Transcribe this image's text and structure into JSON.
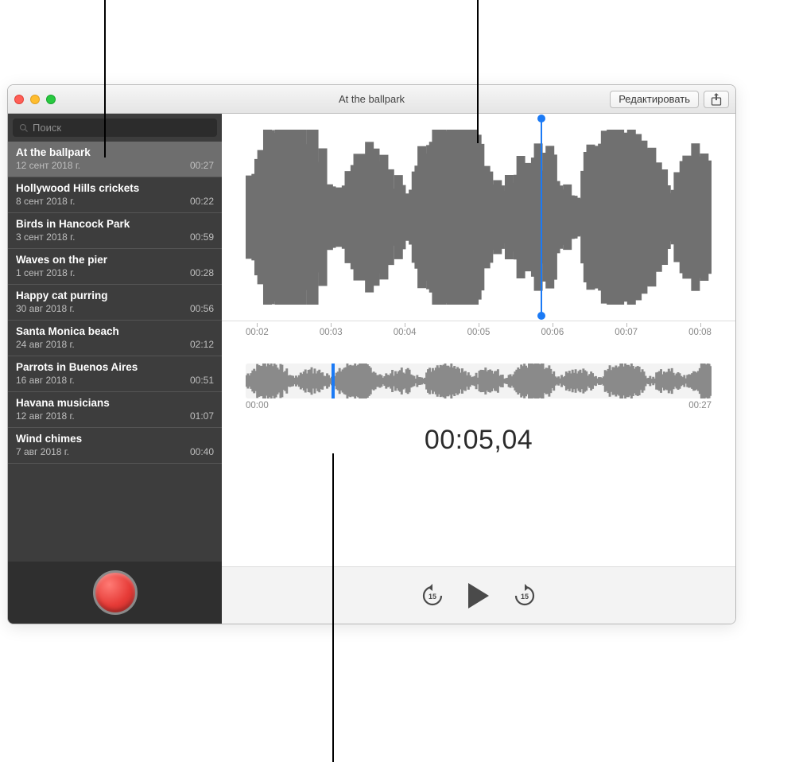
{
  "window": {
    "title": "At the ballpark",
    "edit_button": "Редактировать"
  },
  "sidebar": {
    "search_placeholder": "Поиск",
    "items": [
      {
        "title": "At the ballpark",
        "date": "12 сент 2018 г.",
        "duration": "00:27",
        "selected": true
      },
      {
        "title": "Hollywood Hills crickets",
        "date": "8 сент 2018 г.",
        "duration": "00:22"
      },
      {
        "title": "Birds in Hancock Park",
        "date": "3 сент 2018 г.",
        "duration": "00:59"
      },
      {
        "title": "Waves on the pier",
        "date": "1 сент 2018 г.",
        "duration": "00:28"
      },
      {
        "title": "Happy cat purring",
        "date": "30 авг 2018 г.",
        "duration": "00:56"
      },
      {
        "title": "Santa Monica beach",
        "date": "24 авг 2018 г.",
        "duration": "02:12"
      },
      {
        "title": "Parrots in Buenos Aires",
        "date": "16 авг 2018 г.",
        "duration": "00:51"
      },
      {
        "title": "Havana musicians",
        "date": "12 авг 2018 г.",
        "duration": "01:07"
      },
      {
        "title": "Wind chimes",
        "date": "7 авг 2018 г.",
        "duration": "00:40"
      }
    ]
  },
  "ruler": {
    "ticks": [
      "00:02",
      "00:03",
      "00:04",
      "00:05",
      "00:06",
      "00:07",
      "00:08"
    ]
  },
  "overview": {
    "start": "00:00",
    "end": "00:27"
  },
  "playback": {
    "timecode": "00:05,04",
    "skip_seconds": "15"
  }
}
